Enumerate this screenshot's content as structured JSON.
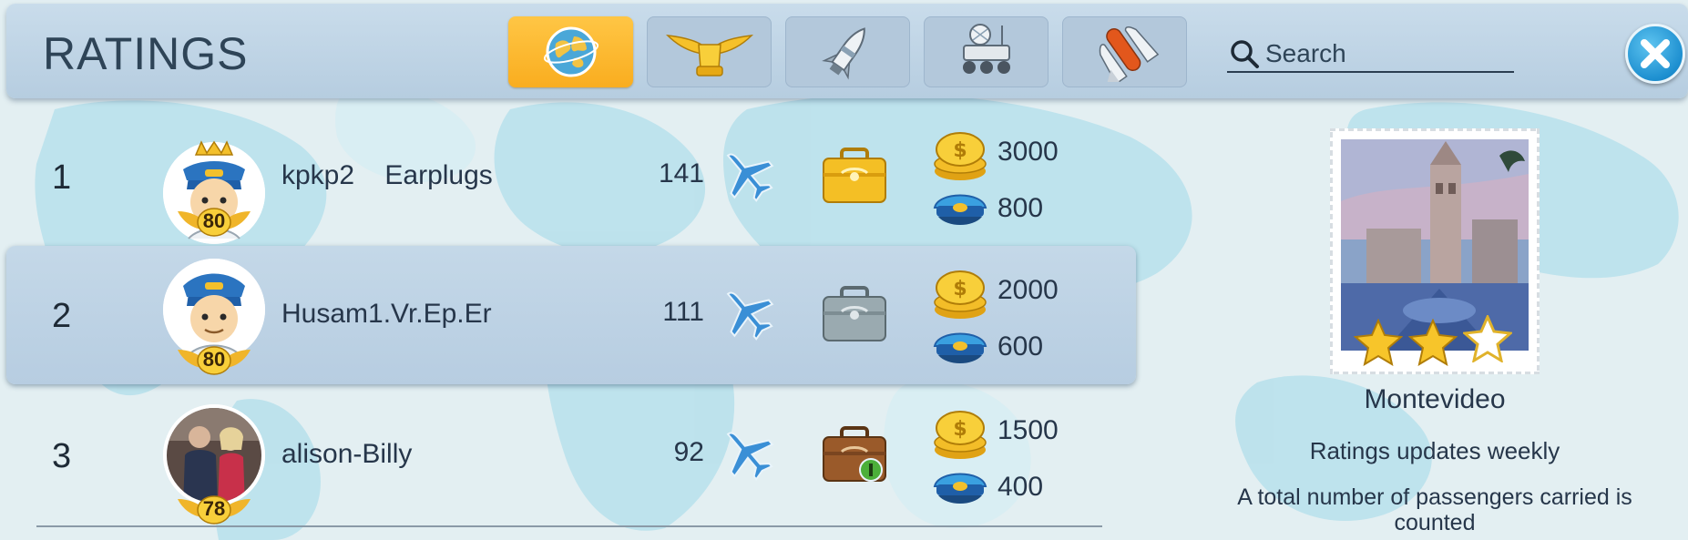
{
  "header": {
    "title": "RATINGS",
    "tabs": [
      {
        "icon": "globe-icon",
        "active": true
      },
      {
        "icon": "pilot-wings-icon",
        "active": false
      },
      {
        "icon": "rocket-icon",
        "active": false
      },
      {
        "icon": "lunar-rover-icon",
        "active": false
      },
      {
        "icon": "space-shuttle-icon",
        "active": false
      }
    ],
    "search_placeholder": "Search"
  },
  "rows": [
    {
      "rank": "1",
      "name": "kpkp2    Earplugs",
      "level": "80",
      "planes": "141",
      "coins": "3000",
      "caps": "800",
      "case": "gold-case-icon",
      "avatar": "pilot-king-avatar",
      "highlighted": false
    },
    {
      "rank": "2",
      "name": "Husam1.Vr.Ep.Er",
      "level": "80",
      "planes": "111",
      "coins": "2000",
      "caps": "600",
      "case": "silver-case-icon",
      "avatar": "pilot-avatar",
      "highlighted": true
    },
    {
      "rank": "3",
      "name": "alison-Billy",
      "level": "78",
      "planes": "92",
      "coins": "1500",
      "caps": "400",
      "case": "bronze-case-icon",
      "avatar": "photo-avatar",
      "highlighted": false
    }
  ],
  "side_panel": {
    "city": "Montevideo",
    "stars": 2,
    "stars_max": 3,
    "note1": "Ratings updates weekly",
    "note2": "A total number of passengers carried is counted"
  },
  "colors": {
    "active_tab": "#f9ad1f",
    "header": "#b6cde0",
    "close_button": "#1d8fd0"
  }
}
